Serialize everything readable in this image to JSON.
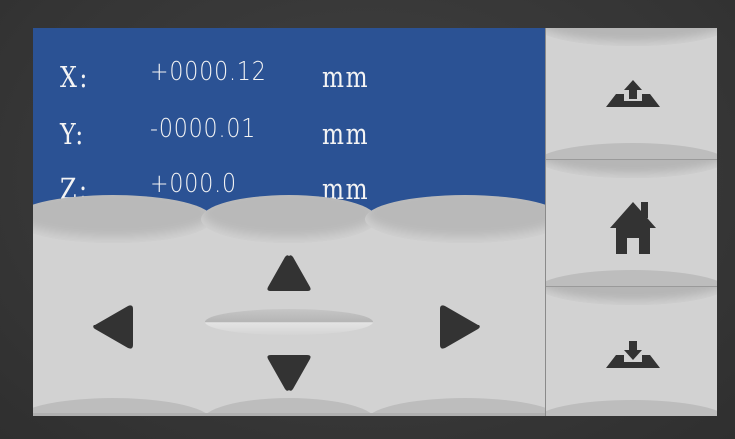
{
  "readout": {
    "x": {
      "axis": "X:",
      "value": "+0000.12",
      "unit": "mm"
    },
    "y": {
      "axis": "Y:",
      "value": "-0000.01",
      "unit": "mm"
    },
    "z": {
      "axis": "Z:",
      "value": "+000.0",
      "unit": "mm"
    }
  },
  "jog_pad": {
    "up_icon": "triangle-up-icon",
    "down_icon": "triangle-down-icon",
    "left_icon": "triangle-left-icon",
    "right_icon": "triangle-right-icon"
  },
  "side_buttons": {
    "z_up_icon": "platform-up-icon",
    "home_icon": "home-icon",
    "z_down_icon": "platform-down-icon"
  },
  "colors": {
    "readout_bg": "#2b5294",
    "readout_text": "#f4f4f4",
    "button_face": "#d2d2d2",
    "icon": "#333333",
    "bezel": "#3c3c3c"
  }
}
